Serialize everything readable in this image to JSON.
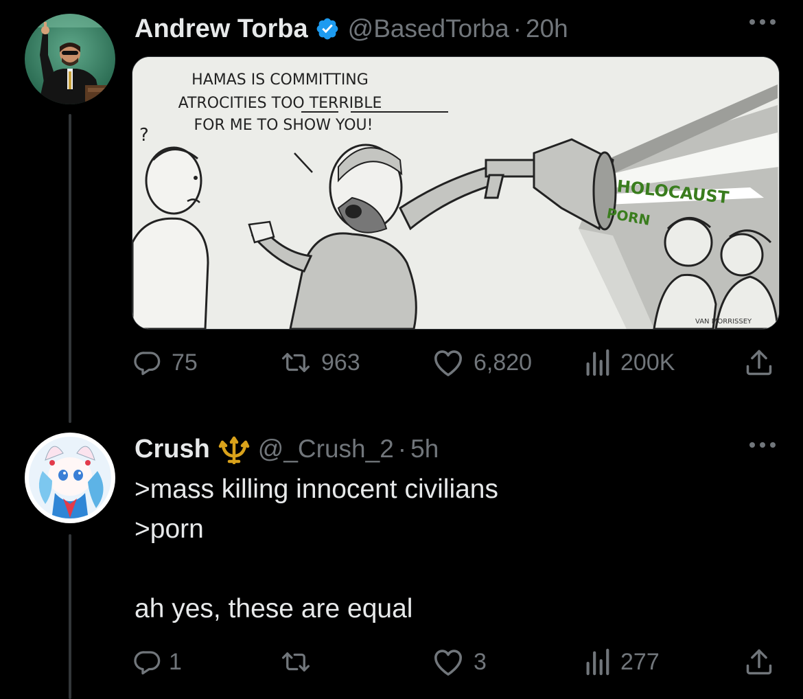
{
  "tweets": [
    {
      "display_name": "Andrew Torba",
      "verified": true,
      "handle": "@BasedTorba",
      "separator": "·",
      "time": "20h",
      "media": {
        "caption_line1": "HAMAS IS COMMITTING",
        "caption_line2": "ATROCITIES TOO TERRIBLE",
        "caption_line3": "FOR ME TO SHOW YOU!",
        "question_mark": "?",
        "projector_label1": "HOLOCAUST",
        "projector_label2": "PORN",
        "artist_signature": "VAN MORRISSEY"
      },
      "replies": "75",
      "reposts": "963",
      "likes": "6,820",
      "views": "200K"
    },
    {
      "display_name": "Crush",
      "handle": "@_Crush_2",
      "separator": "·",
      "time": "5h",
      "text_line1": ">mass killing innocent civilians",
      "text_line2": ">porn",
      "text_line3": "",
      "text_line4": "ah yes, these are equal",
      "replies": "1",
      "reposts": "",
      "likes": "3",
      "views": "277"
    }
  ],
  "colors": {
    "background": "#000000",
    "primary_text": "#e7e9ea",
    "secondary_text": "#71767b",
    "verified_blue": "#1d9bf0",
    "thread_line": "#333639",
    "image_text_green": "#3a7d1e"
  }
}
